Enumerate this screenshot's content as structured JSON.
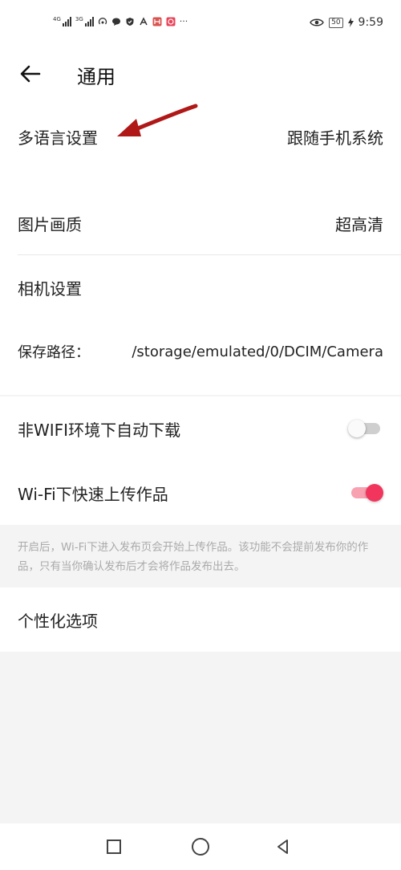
{
  "status_bar": {
    "left_icons": [
      "signal-4g-icon",
      "signal-3g-icon",
      "wifi-hotspot-icon",
      "chat-bubble-icon",
      "shield-icon",
      "app-icon",
      "app-icon",
      "app-icon"
    ],
    "more": "···",
    "battery": "50",
    "time": "9:59",
    "net1": "4G",
    "net2": "3G"
  },
  "header": {
    "title": "通用",
    "back_icon": "arrow-left-icon"
  },
  "settings": {
    "language_label": "多语言设置",
    "language_value": "跟随手机系统",
    "image_quality_label": "图片画质",
    "image_quality_value": "超高清",
    "camera_label": "相机设置",
    "save_path_label": "保存路径：",
    "save_path_value": "/storage/emulated/0/DCIM/Camera",
    "auto_download_label": "非WIFI环境下自动下载",
    "auto_download_on": false,
    "fast_upload_label": "Wi-Fi下快速上传作品",
    "fast_upload_on": true,
    "fast_upload_hint": "开启后，Wi-Fi下进入发布页会开始上传作品。该功能不会提前发布你的作品，只有当你确认发布后才会将作品发布出去。",
    "personalization_label": "个性化选项"
  },
  "colors": {
    "accent": "#f2355c",
    "annotation_arrow": "#b01818"
  }
}
